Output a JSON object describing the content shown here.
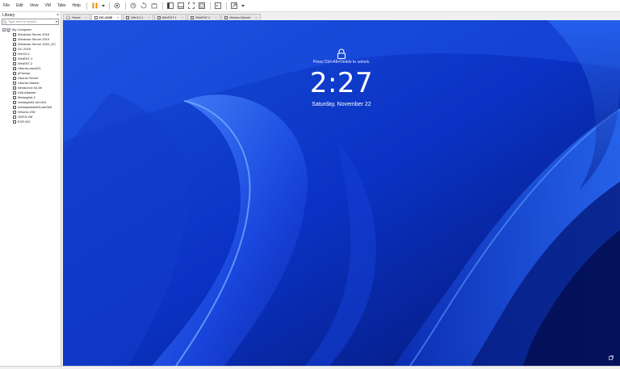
{
  "menu": {
    "items": [
      "File",
      "Edit",
      "View",
      "VM",
      "Tabs",
      "Help"
    ]
  },
  "library": {
    "title": "Library",
    "close": "×",
    "search_placeholder": "Type here to search",
    "root_label": "My Computer",
    "vms": [
      "Windows Server 2016",
      "Windows Server 2019",
      "Windows Server 2022_DC",
      "DC-2025",
      "Win10-1",
      "WinENT-1",
      "WinENT-2",
      "Ubuntu-user001",
      "pFsense",
      "Ubuntu Server",
      "Ubuntu-Wazuh",
      "AlmaLinux 64-bit",
      "Kali-Attacker",
      "Metasploit-2",
      "metasploit2-ub1404",
      "metasploitable3-win2k8",
      "Whonix-GW",
      "GNS3-VM",
      "EVE-NG"
    ]
  },
  "tabs": [
    {
      "label": "Home",
      "active": false
    },
    {
      "label": "DC-2025",
      "active": true
    },
    {
      "label": "Win10-1",
      "active": false
    },
    {
      "label": "WinENT-1",
      "active": false
    },
    {
      "label": "WinENT-2",
      "active": false
    },
    {
      "label": "Ubuntu-Wazuh",
      "active": false
    }
  ],
  "lockscreen": {
    "hint": "Press Ctrl+Alt+Delete to unlock.",
    "time": "2:27",
    "date": "Saturday, November 22"
  },
  "colors": {
    "wallpaper_base": "#0a2db8",
    "pause_accent": "#f08a00"
  }
}
